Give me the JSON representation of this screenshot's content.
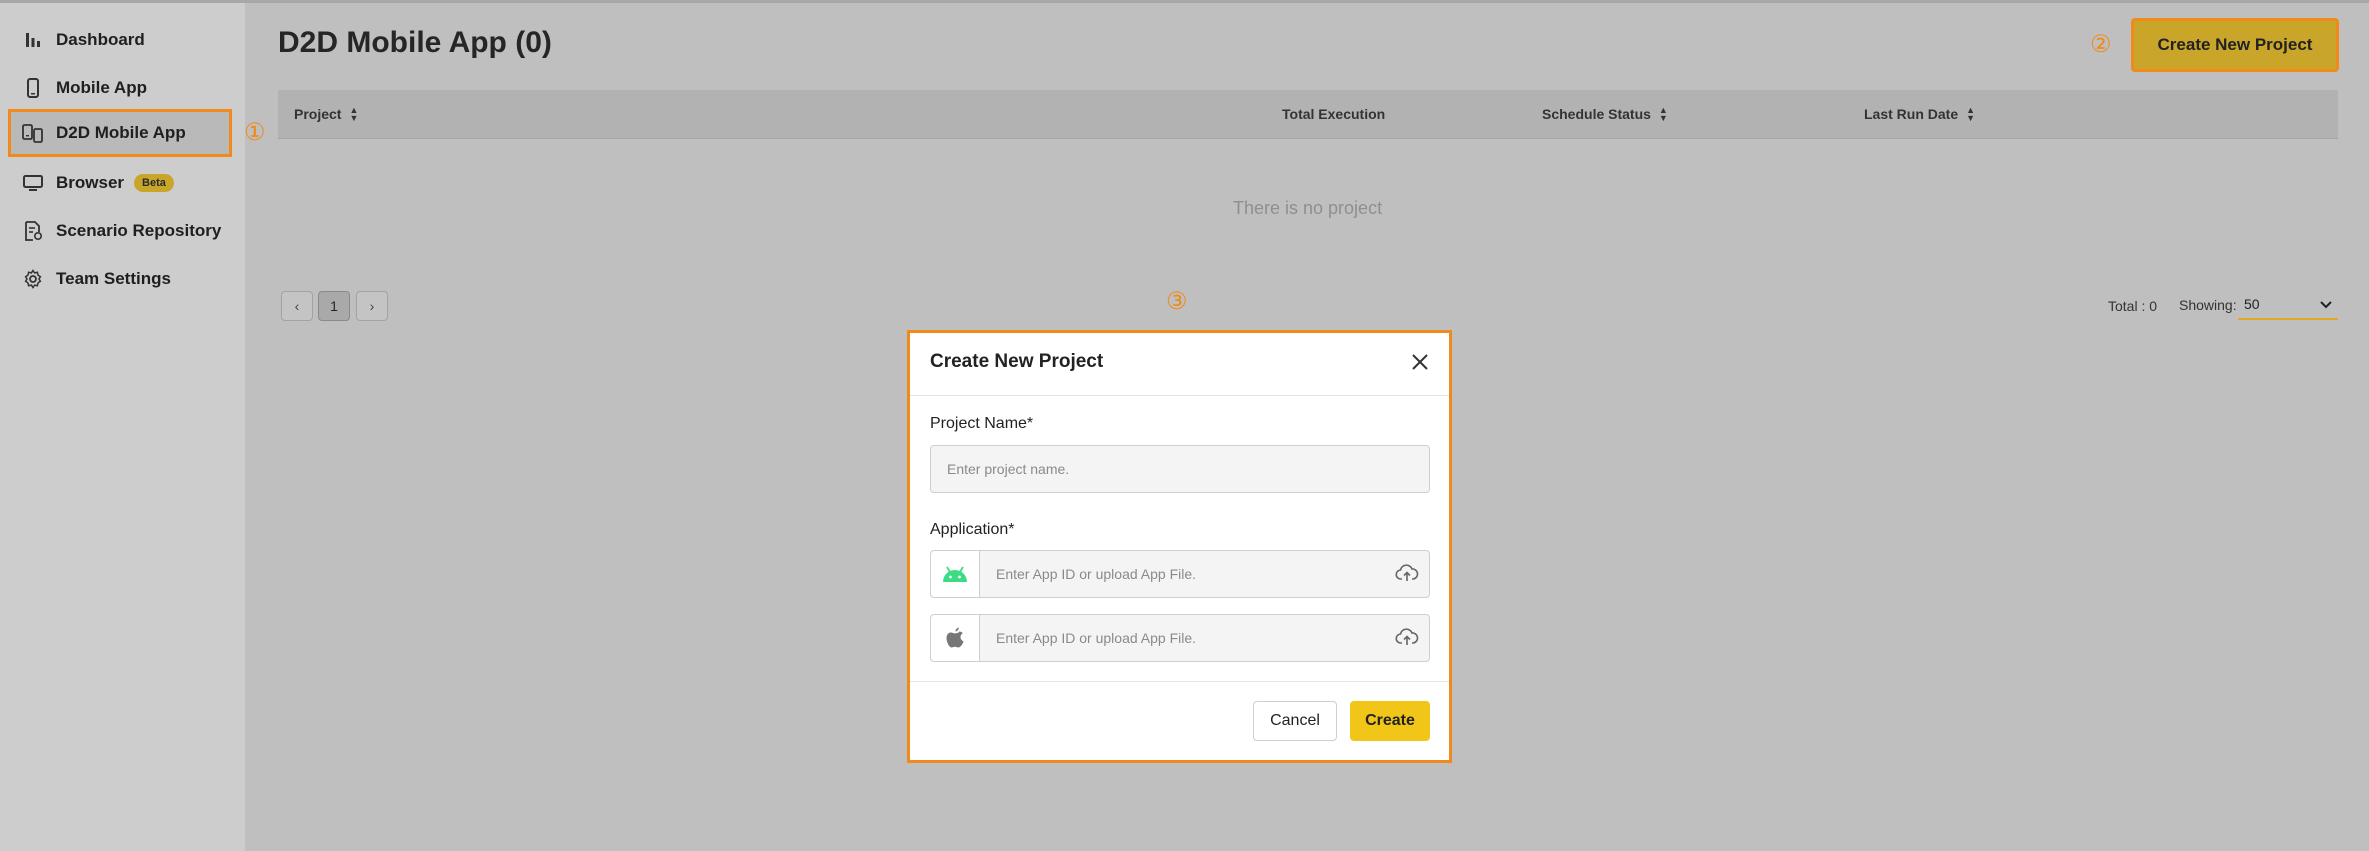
{
  "sidebar": {
    "items": [
      {
        "label": "Dashboard",
        "icon": "bar-chart-icon"
      },
      {
        "label": "Mobile App",
        "icon": "mobile-phone-icon"
      },
      {
        "label": "D2D Mobile App",
        "icon": "multi-device-icon",
        "active": true
      },
      {
        "label": "Browser",
        "icon": "monitor-icon",
        "badge": "Beta"
      },
      {
        "label": "Scenario Repository",
        "icon": "document-settings-icon"
      },
      {
        "label": "Team Settings",
        "icon": "gear-icon"
      }
    ]
  },
  "markers": {
    "one": "①",
    "two": "②",
    "three": "③"
  },
  "header": {
    "title": "D2D Mobile App (0)",
    "create_button": "Create New Project"
  },
  "table": {
    "columns": [
      "Project",
      "Total Execution",
      "Schedule Status",
      "Last Run Date"
    ],
    "empty_text": "There is no project"
  },
  "pagination": {
    "prev": "‹",
    "next": "›",
    "current_page": "1",
    "total": "Total : 0",
    "showing_label": "Showing:",
    "page_size": "50"
  },
  "modal": {
    "title": "Create New Project",
    "project_name_label": "Project Name*",
    "project_name_placeholder": "Enter project name.",
    "application_label": "Application*",
    "android_placeholder": "Enter App ID or upload App File.",
    "ios_placeholder": "Enter App ID or upload App File.",
    "cancel": "Cancel",
    "create": "Create"
  },
  "colors": {
    "accent": "#f08a1c",
    "primary": "#f2c618",
    "android": "#3ddc84"
  }
}
